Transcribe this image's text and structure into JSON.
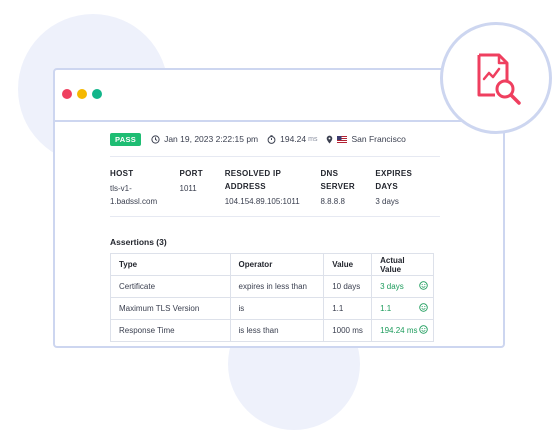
{
  "status": {
    "label": "PASS",
    "date": "Jan 19, 2023 2:22:15 pm",
    "duration": "194.24",
    "duration_unit": "ms",
    "location": "San Francisco"
  },
  "info": {
    "host_label": "HOST",
    "host_value_line1": "tls-v1-",
    "host_value_line2": "1.badssl.com",
    "port_label": "PORT",
    "port_value": "1011",
    "ip_label_line1": "RESOLVED IP",
    "ip_label_line2": "ADDRESS",
    "ip_value": "104.154.89.105:1011",
    "dns_label_line1": "DNS",
    "dns_label_line2": "SERVER",
    "dns_value": "8.8.8.8",
    "expires_label_line1": "EXPIRES",
    "expires_label_line2": "DAYS",
    "expires_value": "3 days"
  },
  "assertions": {
    "title": "Assertions (3)",
    "headers": [
      "Type",
      "Operator",
      "Value",
      "Actual Value"
    ],
    "rows": [
      {
        "type": "Certificate",
        "operator": "expires in less than",
        "value": "10 days",
        "actual": "3 days"
      },
      {
        "type": "Maximum TLS Version",
        "operator": "is",
        "value": "1.1",
        "actual": "1.1"
      },
      {
        "type": "Response Time",
        "operator": "is less than",
        "value": "1000 ms",
        "actual": "194.24 ms"
      }
    ]
  },
  "icons": [
    "clock-icon",
    "timer-icon",
    "location-pin-icon",
    "us-flag-icon",
    "smile-icon",
    "report-search-icon"
  ],
  "colors": {
    "pass": "#1ebd73",
    "actual": "#1d9c5c",
    "accent": "#ef3f5f",
    "window_border": "#cdd6f0"
  }
}
